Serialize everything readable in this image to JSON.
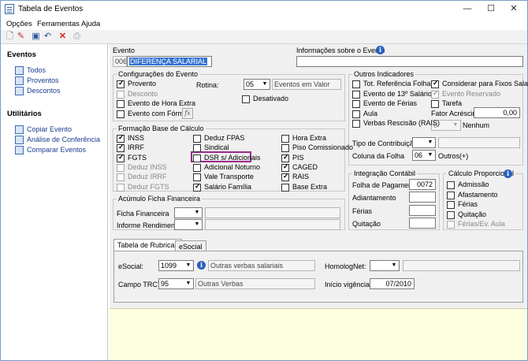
{
  "window": {
    "title": "Tabela de Eventos",
    "minimize": "—",
    "maximize": "☐",
    "close": "✕"
  },
  "menu": [
    "Opções",
    "Ferramentas",
    "Ajuda"
  ],
  "toolbar": [
    "new-doc-icon",
    "edit-icon",
    "save-icon",
    "undo-icon",
    "delete-icon",
    "print-icon"
  ],
  "sidebar": {
    "eventos_title": "Eventos",
    "eventos": [
      "Todos",
      "Proventos",
      "Descontos"
    ],
    "utilitarios_title": "Utilitários",
    "utilitarios": [
      "Copiar Evento",
      "Análise de Conferência",
      "Comparar Eventos"
    ]
  },
  "evento": {
    "label": "Evento",
    "code": "006",
    "name": "DIFERENÇA SALARIAL",
    "info_label": "Informações sobre o Evento",
    "info_value": ""
  },
  "config": {
    "title": "Configurações do Evento",
    "provento": "Provento",
    "desconto": "Desconto",
    "hora_extra": "Evento de Hora Extra",
    "formula": "Evento com Fórmula",
    "rotina_label": "Rotina:",
    "rotina_value": "05",
    "rotina_desc": "Eventos em Valor",
    "desativado": "Desativado",
    "fx": "fx"
  },
  "formacao": {
    "title": "Formação Base de Cálculo",
    "col1": [
      {
        "label": "INSS",
        "checked": true,
        "disabled": false
      },
      {
        "label": "IRRF",
        "checked": true,
        "disabled": false
      },
      {
        "label": "FGTS",
        "checked": true,
        "disabled": false
      },
      {
        "label": "Deduz INSS",
        "checked": false,
        "disabled": true
      },
      {
        "label": "Deduz IRRF",
        "checked": false,
        "disabled": true
      },
      {
        "label": "Deduz FGTS",
        "checked": false,
        "disabled": true
      }
    ],
    "col2": [
      {
        "label": "Deduz FPAS",
        "checked": false
      },
      {
        "label": "Sindical",
        "checked": false
      },
      {
        "label": "DSR s/ Adicionais",
        "checked": false
      },
      {
        "label": "Adicional Noturno",
        "checked": false
      },
      {
        "label": "Vale Transporte",
        "checked": false
      },
      {
        "label": "Salário Família",
        "checked": true
      }
    ],
    "col3": [
      {
        "label": "Hora Extra",
        "checked": false
      },
      {
        "label": "Piso Comissionado",
        "checked": false
      },
      {
        "label": "PIS",
        "checked": true
      },
      {
        "label": "CAGED",
        "checked": true
      },
      {
        "label": "RAIS",
        "checked": true
      },
      {
        "label": "Base Extra",
        "checked": false
      }
    ]
  },
  "acumulo": {
    "title": "Acúmulo Ficha Financeira",
    "ficha": "Ficha Financeira",
    "informe": "Informe Rendimentos"
  },
  "outros": {
    "title": "Outros Indicadores",
    "left": [
      {
        "label": "Tot. Referência Folha",
        "checked": false
      },
      {
        "label": "Evento de 13º Salário",
        "checked": false
      },
      {
        "label": "Evento de Férias",
        "checked": false
      },
      {
        "label": "Aula",
        "checked": false
      },
      {
        "label": "Verbas Rescisão (RAIS)",
        "checked": false
      }
    ],
    "right": [
      {
        "label": "Considerar para Fixos Salariais",
        "checked": true,
        "disabled": false
      },
      {
        "label": "Evento Reservado",
        "checked": true,
        "disabled": true
      },
      {
        "label": "Tarefa",
        "checked": false,
        "disabled": false
      }
    ],
    "fator_label": "Fator Acréscimo",
    "fator_value": "0,00",
    "nenhum_value": "0",
    "nenhum_label": "Nenhum",
    "tipo_label": "Tipo de Contribuição",
    "coluna_label": "Coluna da Folha",
    "coluna_value": "06",
    "coluna_desc": "Outros(+)"
  },
  "integracao": {
    "title": "Integração Contábil",
    "folha": "Folha de Pagamento",
    "folha_value": "0072",
    "adiantamento": "Adiantamento",
    "ferias": "Férias",
    "quitacao": "Quitação"
  },
  "proporcional": {
    "title": "Cálculo Proporcional",
    "items": [
      {
        "label": "Admissão",
        "checked": false,
        "disabled": false
      },
      {
        "label": "Afastamento",
        "checked": false,
        "disabled": false
      },
      {
        "label": "Férias",
        "checked": false,
        "disabled": false
      },
      {
        "label": "Quitação",
        "checked": false,
        "disabled": false
      },
      {
        "label": "Férias/Ev. Aula",
        "checked": false,
        "disabled": true
      }
    ]
  },
  "tabs": [
    "Tabela de Rubricas",
    "eSocial"
  ],
  "rubricas": {
    "esocial_label": "eSocial:",
    "esocial_value": "1099",
    "esocial_desc": "Outras verbas salariais",
    "homolog_label": "HomologNet:",
    "trct_label": "Campo TRCT:",
    "trct_value": "95",
    "trct_desc": "Outras Verbas",
    "vigencia_label": "Início vigência:",
    "vigencia_value": "07/2010"
  }
}
